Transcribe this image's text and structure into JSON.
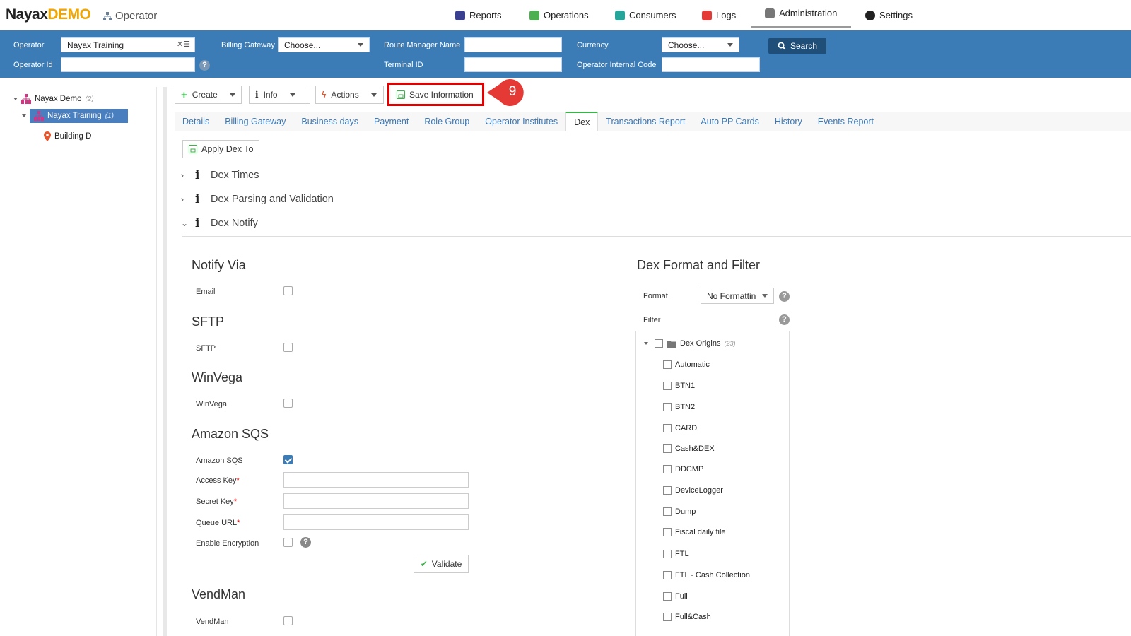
{
  "brand": {
    "name": "Nayax",
    "demo": "DEMO",
    "section": "Operator"
  },
  "nav": [
    {
      "label": "Reports",
      "color": "#3a3f8f"
    },
    {
      "label": "Operations",
      "color": "#4caf50"
    },
    {
      "label": "Consumers",
      "color": "#26a69a"
    },
    {
      "label": "Logs",
      "color": "#e53935"
    },
    {
      "label": "Administration",
      "color": "#777777"
    },
    {
      "label": "Settings",
      "color": "#222222"
    }
  ],
  "filters": {
    "operator_label": "Operator",
    "operator_value": "Nayax Training",
    "operator_id_label": "Operator Id",
    "operator_id_value": "",
    "billing_gateway_label": "Billing Gateway",
    "billing_gateway_value": "Choose...",
    "route_manager_label": "Route Manager Name",
    "route_manager_value": "",
    "terminal_id_label": "Terminal ID",
    "terminal_id_value": "",
    "currency_label": "Currency",
    "currency_value": "Choose...",
    "operator_internal_code_label": "Operator Internal Code",
    "operator_internal_code_value": "",
    "search_label": "Search"
  },
  "tree": [
    {
      "label": "Nayax Demo",
      "count": "(2)"
    },
    {
      "label": "Nayax Training",
      "count": "(1)"
    },
    {
      "label": "Building D",
      "count": ""
    }
  ],
  "toolbar": {
    "create": "Create",
    "info": "Info",
    "actions": "Actions",
    "save": "Save Information",
    "step_badge": "9"
  },
  "tabs": [
    "Details",
    "Billing Gateway",
    "Business days",
    "Payment",
    "Role Group",
    "Operator Institutes",
    "Dex",
    "Transactions Report",
    "Auto PP Cards",
    "History",
    "Events Report"
  ],
  "apply_dex": "Apply Dex To",
  "sections": [
    "Dex Times",
    "Dex Parsing and Validation",
    "Dex Notify"
  ],
  "notify": {
    "notify_via_title": "Notify Via",
    "email_label": "Email",
    "sftp_title": "SFTP",
    "sftp_label": "SFTP",
    "winvega_title": "WinVega",
    "winvega_label": "WinVega",
    "sqs_title": "Amazon SQS",
    "sqs_label": "Amazon SQS",
    "access_key_label": "Access Key",
    "secret_key_label": "Secret Key",
    "queue_url_label": "Queue URL",
    "required_mark": "*",
    "enable_encryption_label": "Enable Encryption",
    "validate_label": "Validate",
    "vendman_title": "VendMan",
    "vendman_label": "VendMan"
  },
  "dex_format": {
    "title": "Dex Format and Filter",
    "format_label": "Format",
    "format_value": "No Formattin",
    "filter_label": "Filter",
    "root_label": "Dex Origins",
    "root_count": "(23)",
    "items": [
      "Automatic",
      "BTN1",
      "BTN2",
      "CARD",
      "Cash&DEX",
      "DDCMP",
      "DeviceLogger",
      "Dump",
      "Fiscal daily file",
      "FTL",
      "FTL - Cash Collection",
      "Full",
      "Full&Cash"
    ]
  }
}
